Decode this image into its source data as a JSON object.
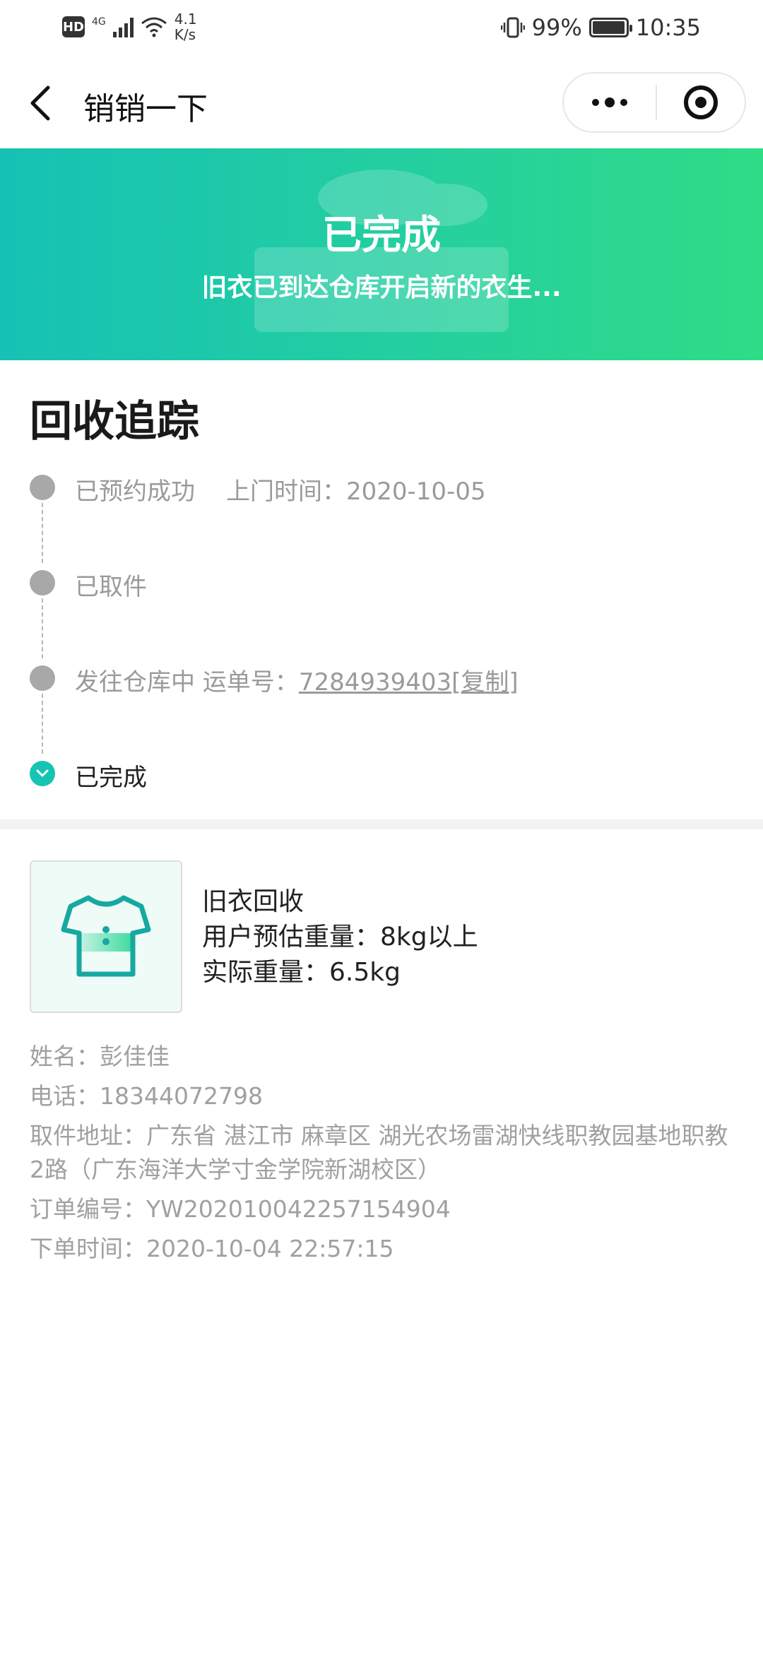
{
  "status_bar": {
    "hd": "HD",
    "network": "4G",
    "speed_value": "4.1",
    "speed_unit": "K/s",
    "battery": "99%",
    "battery_level": 0.99,
    "time": "10:35"
  },
  "nav": {
    "title": "销销一下",
    "back_icon": "chevron-left-icon",
    "more_icon": "more-dots-icon",
    "close_icon": "target-close-icon"
  },
  "banner": {
    "title": "已完成",
    "subtitle": "旧衣已到达仓库开启新的衣生..."
  },
  "tracking": {
    "title": "回收追踪",
    "steps": [
      {
        "label": "已预约成功",
        "extra_label": "上门时间：",
        "extra_value": "2020-10-05"
      },
      {
        "label": "已取件"
      },
      {
        "label": "发往仓库中 运单号：",
        "waybill": "7284939403",
        "copy": "[复制]"
      },
      {
        "label": "已完成"
      }
    ]
  },
  "product": {
    "icon": "tshirt-icon",
    "name": "旧衣回收",
    "estimate": "用户预估重量：8kg以上",
    "actual": "实际重量：6.5kg"
  },
  "details": {
    "name": "姓名：彭佳佳",
    "phone": "电话：18344072798",
    "address": "取件地址：广东省 湛江市 麻章区 湖光农场雷湖快线职教园基地职教2路（广东海洋大学寸金学院新湖校区）",
    "order_no": "订单编号：YW202010042257154904",
    "order_time": "下单时间：2020-10-04 22:57:15"
  },
  "colors": {
    "accent": "#17c3b2",
    "banner_start": "#16c2b4",
    "banner_end": "#2fdc86",
    "muted_text": "#9a9a9a"
  }
}
